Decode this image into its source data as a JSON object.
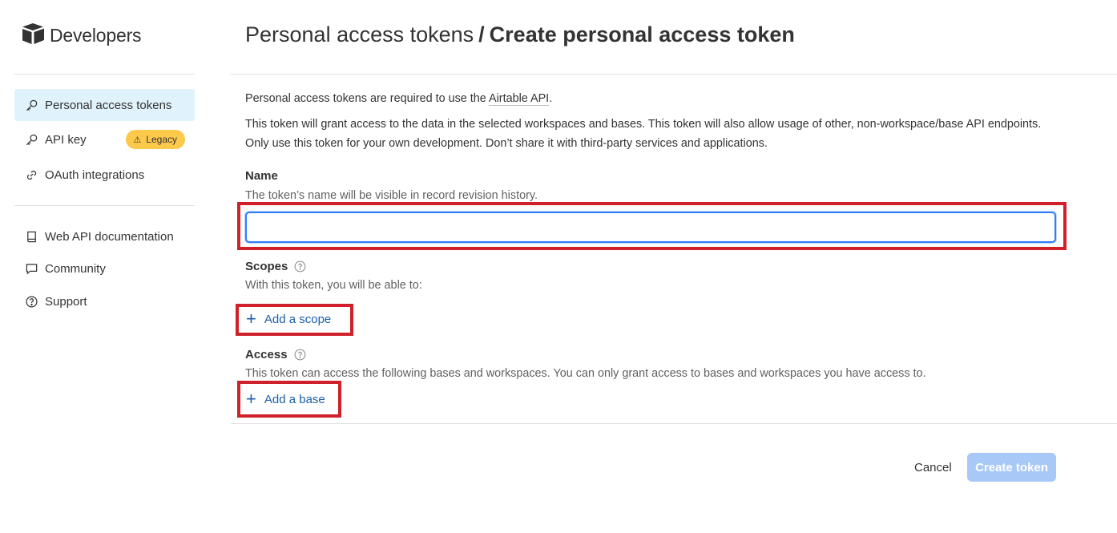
{
  "brand": {
    "name": "Developers",
    "icon": "airtable-logo-icon"
  },
  "sidebar": {
    "items": [
      {
        "label": "Personal access tokens",
        "icon": "key-icon",
        "active": true
      },
      {
        "label": "API key",
        "icon": "key-icon",
        "badge": "Legacy",
        "badge_icon": "warning-icon",
        "badge_color": "#fcc94a"
      },
      {
        "label": "OAuth integrations",
        "icon": "link-icon"
      },
      {
        "label": "Web API documentation",
        "icon": "book-icon"
      },
      {
        "label": "Community",
        "icon": "chat-icon"
      },
      {
        "label": "Support",
        "icon": "help-circle-icon"
      }
    ]
  },
  "header": {
    "breadcrumb_parent": "Personal access tokens",
    "separator": "/",
    "title": "Create personal access token"
  },
  "intro": {
    "line1_prefix": "Personal access tokens are required to use the ",
    "line1_link": "Airtable API",
    "line1_suffix": ".",
    "line2": "This token will grant access to the data in the selected workspaces and bases. This token will also allow usage of other, non-workspace/base API endpoints.",
    "line3": "Only use this token for your own development. Don’t share it with third-party services and applications."
  },
  "name_section": {
    "label": "Name",
    "hint": "The token’s name will be visible in record revision history.",
    "value": "",
    "placeholder": ""
  },
  "scopes_section": {
    "label": "Scopes",
    "hint": "With this token, you will be able to:",
    "add_label": "Add a scope"
  },
  "access_section": {
    "label": "Access",
    "hint": "This token can access the following bases and workspaces. You can only grant access to bases and workspaces you have access to.",
    "add_label": "Add a base"
  },
  "footer": {
    "cancel_label": "Cancel",
    "create_label": "Create token"
  },
  "colors": {
    "active_nav_bg": "#e0f2fb",
    "link_blue": "#1b5fa8",
    "primary_disabled": "#a8c9f8",
    "highlight_red": "#d0202a",
    "input_focus": "#2d7ff9"
  }
}
